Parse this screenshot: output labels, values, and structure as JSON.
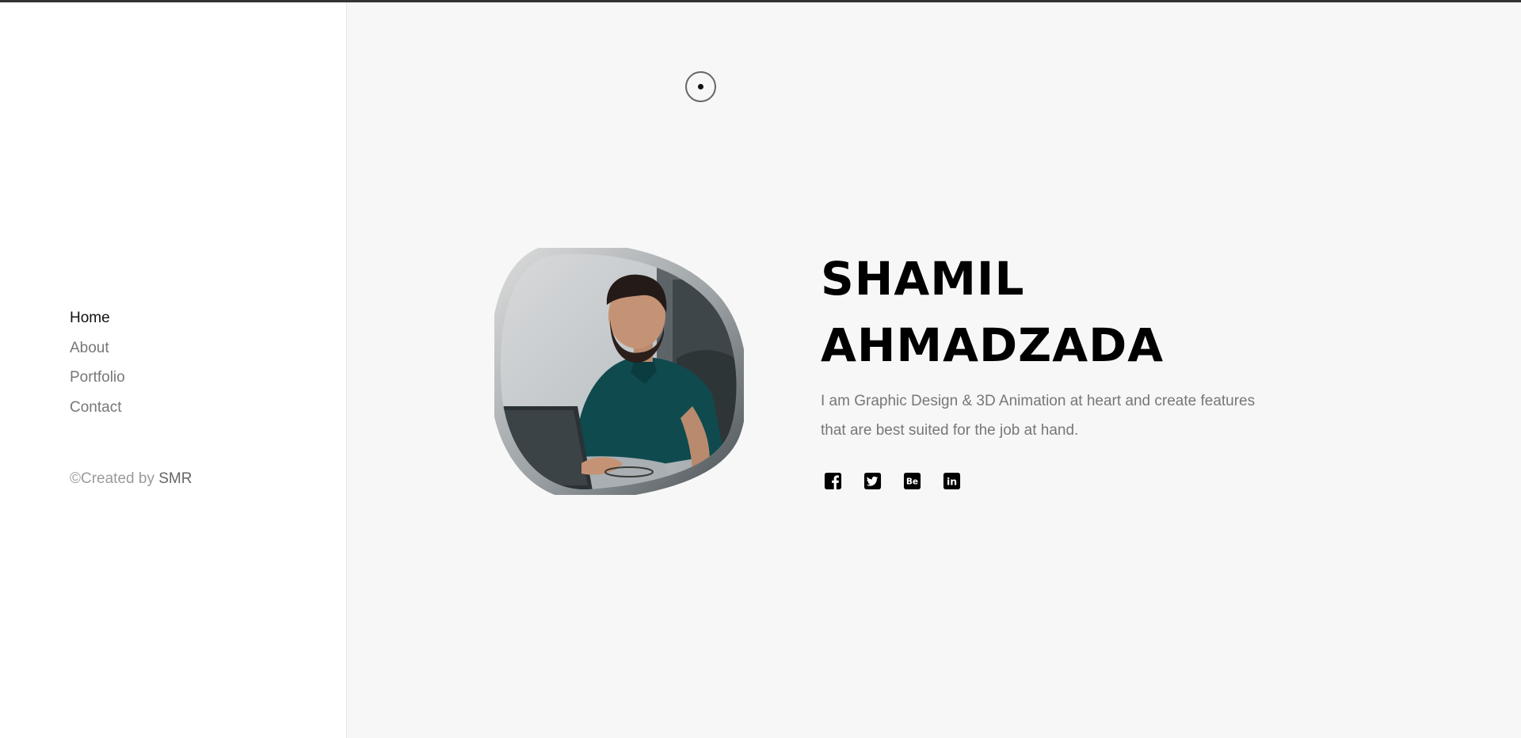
{
  "sidebar": {
    "nav": [
      {
        "label": "Home",
        "active": true
      },
      {
        "label": "About",
        "active": false
      },
      {
        "label": "Portfolio",
        "active": false
      },
      {
        "label": "Contact",
        "active": false
      }
    ],
    "copyright_prefix": "©Created by ",
    "copyright_brand": "SMR"
  },
  "hero": {
    "first_name": "SHAMIL",
    "last_name": "AHMADZADA",
    "description": "I am Graphic Design & 3D Animation at heart and create features that are best suited for the job at hand.",
    "social_icons": [
      "facebook-icon",
      "twitter-icon",
      "behance-icon",
      "linkedin-icon"
    ],
    "behance_glyph": "Be",
    "linkedin_glyph": "in"
  },
  "colors": {
    "background": "#f7f7f7",
    "sidebar": "#ffffff",
    "title": "#000000",
    "text_muted": "#777777",
    "shirt": "#0f4a4f"
  }
}
